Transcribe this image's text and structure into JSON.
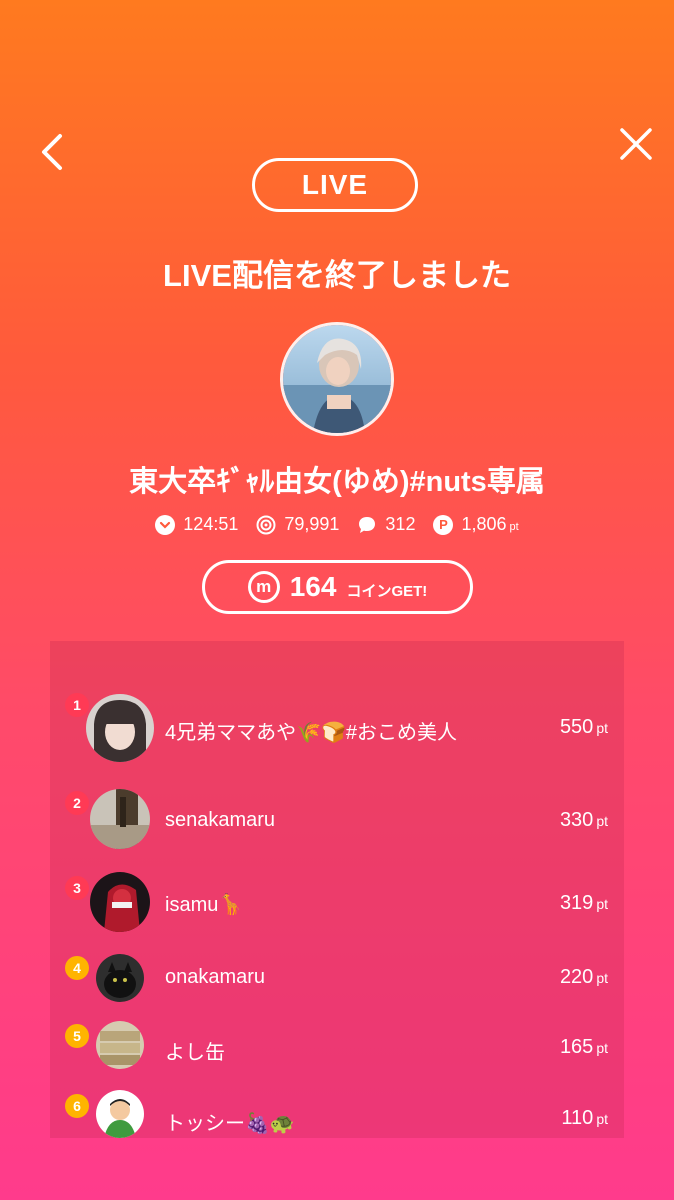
{
  "nav": {
    "back_icon": "chevron-left-icon",
    "close_icon": "close-icon"
  },
  "live_label": "LIVE",
  "headline": "LIVE配信を終了しました",
  "streamer": {
    "name": "東大卒ｷﾞｬﾙ由女(ゆめ)#nuts専属"
  },
  "stats": {
    "time": "124:51",
    "viewers": "79,991",
    "comments": "312",
    "points": "1,806",
    "points_unit": "pt",
    "points_icon_letter": "P"
  },
  "coin": {
    "icon_letter": "m",
    "amount": "164",
    "label": "コインGET!"
  },
  "ranking": [
    {
      "rank": "1",
      "name": "4兄弟ママあや🌾🍞#おこめ美人",
      "points": "550",
      "unit": "pt",
      "badge_color": "#ff3a55"
    },
    {
      "rank": "2",
      "name": "senakamaru",
      "points": "330",
      "unit": "pt",
      "badge_color": "#ff3a55"
    },
    {
      "rank": "3",
      "name": " isamu🦒",
      "points": "319",
      "unit": "pt",
      "badge_color": "#ff3a55"
    },
    {
      "rank": "4",
      "name": "onakamaru",
      "points": "220",
      "unit": "pt",
      "badge_color": "#ffb400"
    },
    {
      "rank": "5",
      "name": "よし缶",
      "points": "165",
      "unit": "pt",
      "badge_color": "#ffb400"
    },
    {
      "rank": "6",
      "name": "トッシー🍇🐢",
      "points": "110",
      "unit": "pt",
      "badge_color": "#ffb400"
    }
  ]
}
